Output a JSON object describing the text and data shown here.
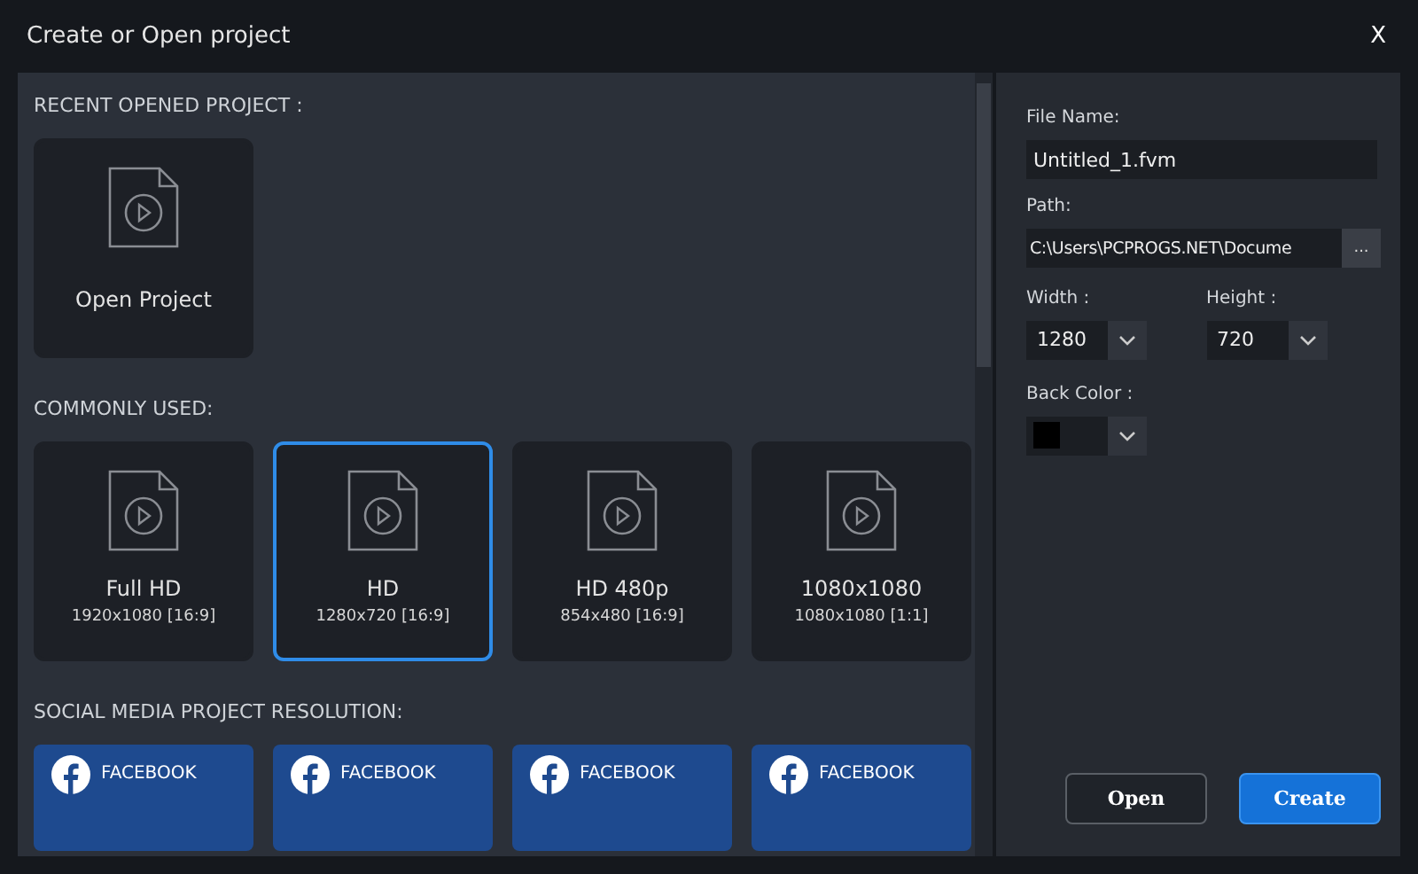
{
  "window": {
    "title": "Create or Open project",
    "close": "X"
  },
  "recent": {
    "heading": "RECENT OPENED PROJECT :",
    "items": [
      {
        "label": "Open Project"
      }
    ]
  },
  "common": {
    "heading": "COMMONLY USED:",
    "items": [
      {
        "title": "Full HD",
        "size": "1920x1080 [16:9]",
        "selected": false
      },
      {
        "title": "HD",
        "size": "1280x720 [16:9]",
        "selected": true
      },
      {
        "title": "HD 480p",
        "size": "854x480 [16:9]",
        "selected": false
      },
      {
        "title": "1080x1080",
        "size": "1080x1080 [1:1]",
        "selected": false
      }
    ]
  },
  "social": {
    "heading": "SOCIAL MEDIA PROJECT RESOLUTION:",
    "items": [
      {
        "label": "FACEBOOK"
      },
      {
        "label": "FACEBOOK"
      },
      {
        "label": "FACEBOOK"
      },
      {
        "label": "FACEBOOK"
      }
    ]
  },
  "form": {
    "file_name": {
      "label": "File Name:",
      "value": "Untitled_1.fvm"
    },
    "path": {
      "label": "Path:",
      "value": "C:\\Users\\PCPROGS.NET\\Docume",
      "browse": "..."
    },
    "width": {
      "label": "Width :",
      "value": "1280"
    },
    "height": {
      "label": "Height :",
      "value": "720"
    },
    "back_color": {
      "label": "Back Color :",
      "color": "#000000"
    }
  },
  "buttons": [
    {
      "label": "Open",
      "kind": "secondary"
    },
    {
      "label": "Create",
      "kind": "primary"
    }
  ]
}
